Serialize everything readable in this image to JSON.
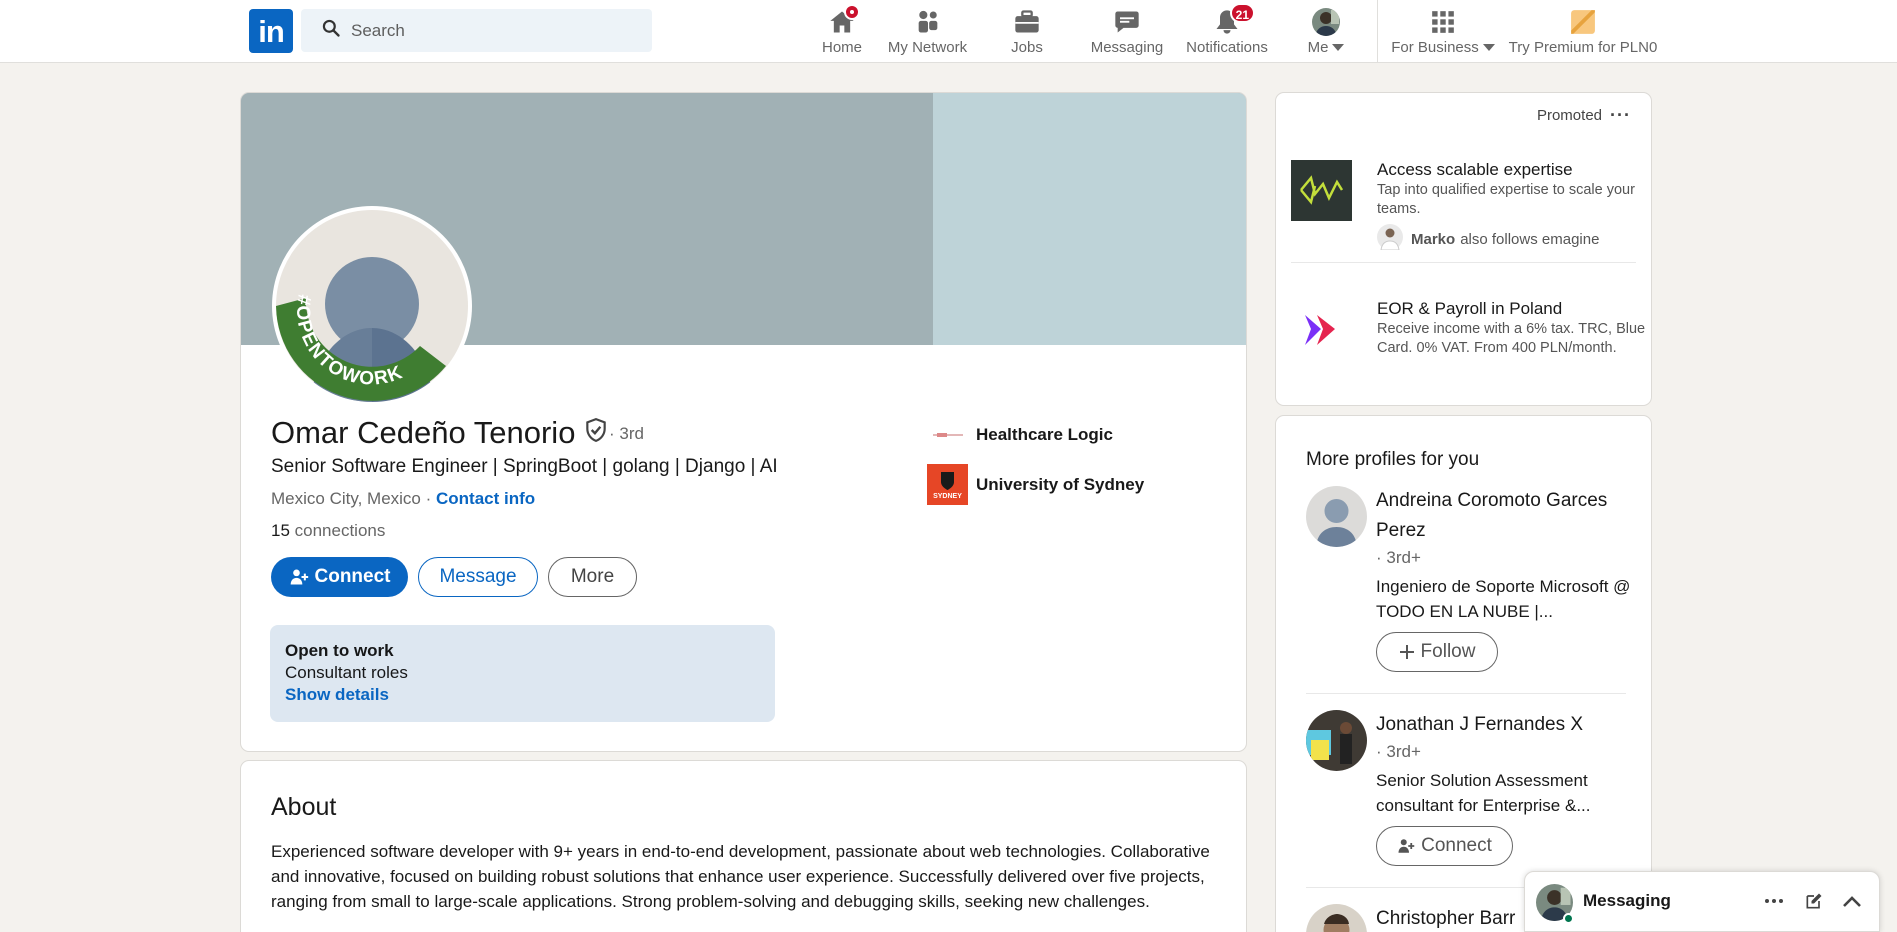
{
  "nav": {
    "logo": "in",
    "search_placeholder": "Search",
    "items": [
      {
        "label": "Home",
        "badge": ""
      },
      {
        "label": "My Network",
        "badge": ""
      },
      {
        "label": "Jobs",
        "badge": ""
      },
      {
        "label": "Messaging",
        "badge": ""
      },
      {
        "label": "Notifications",
        "badge": "21"
      },
      {
        "label": "Me",
        "badge": ""
      },
      {
        "label": "For Business",
        "badge": ""
      },
      {
        "label": "Try Premium for PLN0",
        "badge": ""
      }
    ]
  },
  "profile": {
    "name": "Omar Cedeño Tenorio",
    "degree": "· 3rd",
    "headline": "Senior Software Engineer | SpringBoot | golang | Django | AI",
    "location": "Mexico City, Mexico",
    "location_sep": " · ",
    "contact_info": "Contact info",
    "connections_count": "15",
    "connections_label": " connections",
    "buttons": {
      "connect": "Connect",
      "message": "Message",
      "more": "More"
    },
    "open_to_work": {
      "title": "Open to work",
      "roles": "Consultant roles",
      "link": "Show details"
    },
    "avatar_frame_text": "#OPENTOWORK",
    "experience": [
      {
        "name": "Healthcare Logic"
      },
      {
        "name": "University of Sydney",
        "logo_text": "SYDNEY"
      }
    ]
  },
  "about": {
    "title": "About",
    "text": "Experienced software developer with 9+ years in end-to-end development, passionate about web technologies. Collaborative and innovative, focused on building robust solutions that enhance user experience. Successfully delivered over five projects, ranging from small to large-scale applications. Strong problem-solving and debugging skills, seeking new challenges."
  },
  "ads": {
    "promoted": "Promoted",
    "items": [
      {
        "title": "Access scalable expertise",
        "desc": "Tap into qualified expertise to scale your teams.",
        "follower": "Marko",
        "follower_text": "also follows emagine"
      },
      {
        "title": "EOR & Payroll in Poland",
        "desc": "Receive income with a 6% tax. TRC, Blue Card. 0% VAT. From 400 PLN/month."
      }
    ]
  },
  "more_profiles": {
    "title": "More profiles for you",
    "people": [
      {
        "name": "Andreina Coromoto Garces Perez",
        "degree": "· 3rd+",
        "headline": "Ingeniero de Soporte Microsoft @ TODO EN LA NUBE |...",
        "action": "Follow"
      },
      {
        "name": "Jonathan J Fernandes X",
        "degree": "· 3rd+",
        "headline": "Senior Solution Assessment consultant for Enterprise &...",
        "action": "Connect"
      },
      {
        "name": "Christopher Barr"
      }
    ]
  },
  "messaging": {
    "title": "Messaging"
  },
  "colors": {
    "brand": "#0a66c2",
    "badge": "#cb112d",
    "background": "#f4f2ee",
    "open_to_work_green": "#3f7d31"
  }
}
